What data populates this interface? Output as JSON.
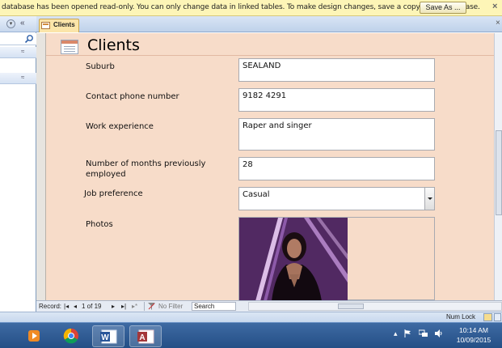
{
  "message_bar": {
    "text": "database has been opened read-only. You can only change data in linked tables. To make design changes, save a copy of the database.",
    "save_as_label": "Save As ...",
    "close_glyph": "×"
  },
  "nav_pane": {
    "menu_glyph": "▾",
    "collapse_glyph": "«",
    "group_glyph": "≈"
  },
  "tab": {
    "label": "Clients",
    "close_glyph": "×"
  },
  "form": {
    "title": "Clients",
    "fields": {
      "suburb": {
        "label": "Suburb",
        "value": "SEALAND"
      },
      "phone": {
        "label": "Contact phone number",
        "value": "9182 4291"
      },
      "experience": {
        "label": "Work experience",
        "value": "Raper and singer"
      },
      "months": {
        "label": "Number of months previously employed",
        "value": "28"
      },
      "job_pref": {
        "label": "Job preference",
        "value": "Casual"
      },
      "photos": {
        "label": "Photos"
      }
    }
  },
  "record_nav": {
    "record_label": "Record:",
    "first_glyph": "|◂",
    "prev_glyph": "◂",
    "position": "1 of 19",
    "next_glyph": "▸",
    "last_glyph": "▸|",
    "new_glyph": "▸*",
    "filter_label": "No Filter",
    "search_label": "Search"
  },
  "status_bar": {
    "num_lock": "Num Lock"
  },
  "taskbar": {
    "tray_glyph": "▴",
    "clock_time": "10:14 AM",
    "clock_date": "10/09/2015"
  },
  "colors": {
    "form_background": "#f7dcc9",
    "message_bar": "#fdf5b7",
    "taskbar": "#2c5a92"
  }
}
